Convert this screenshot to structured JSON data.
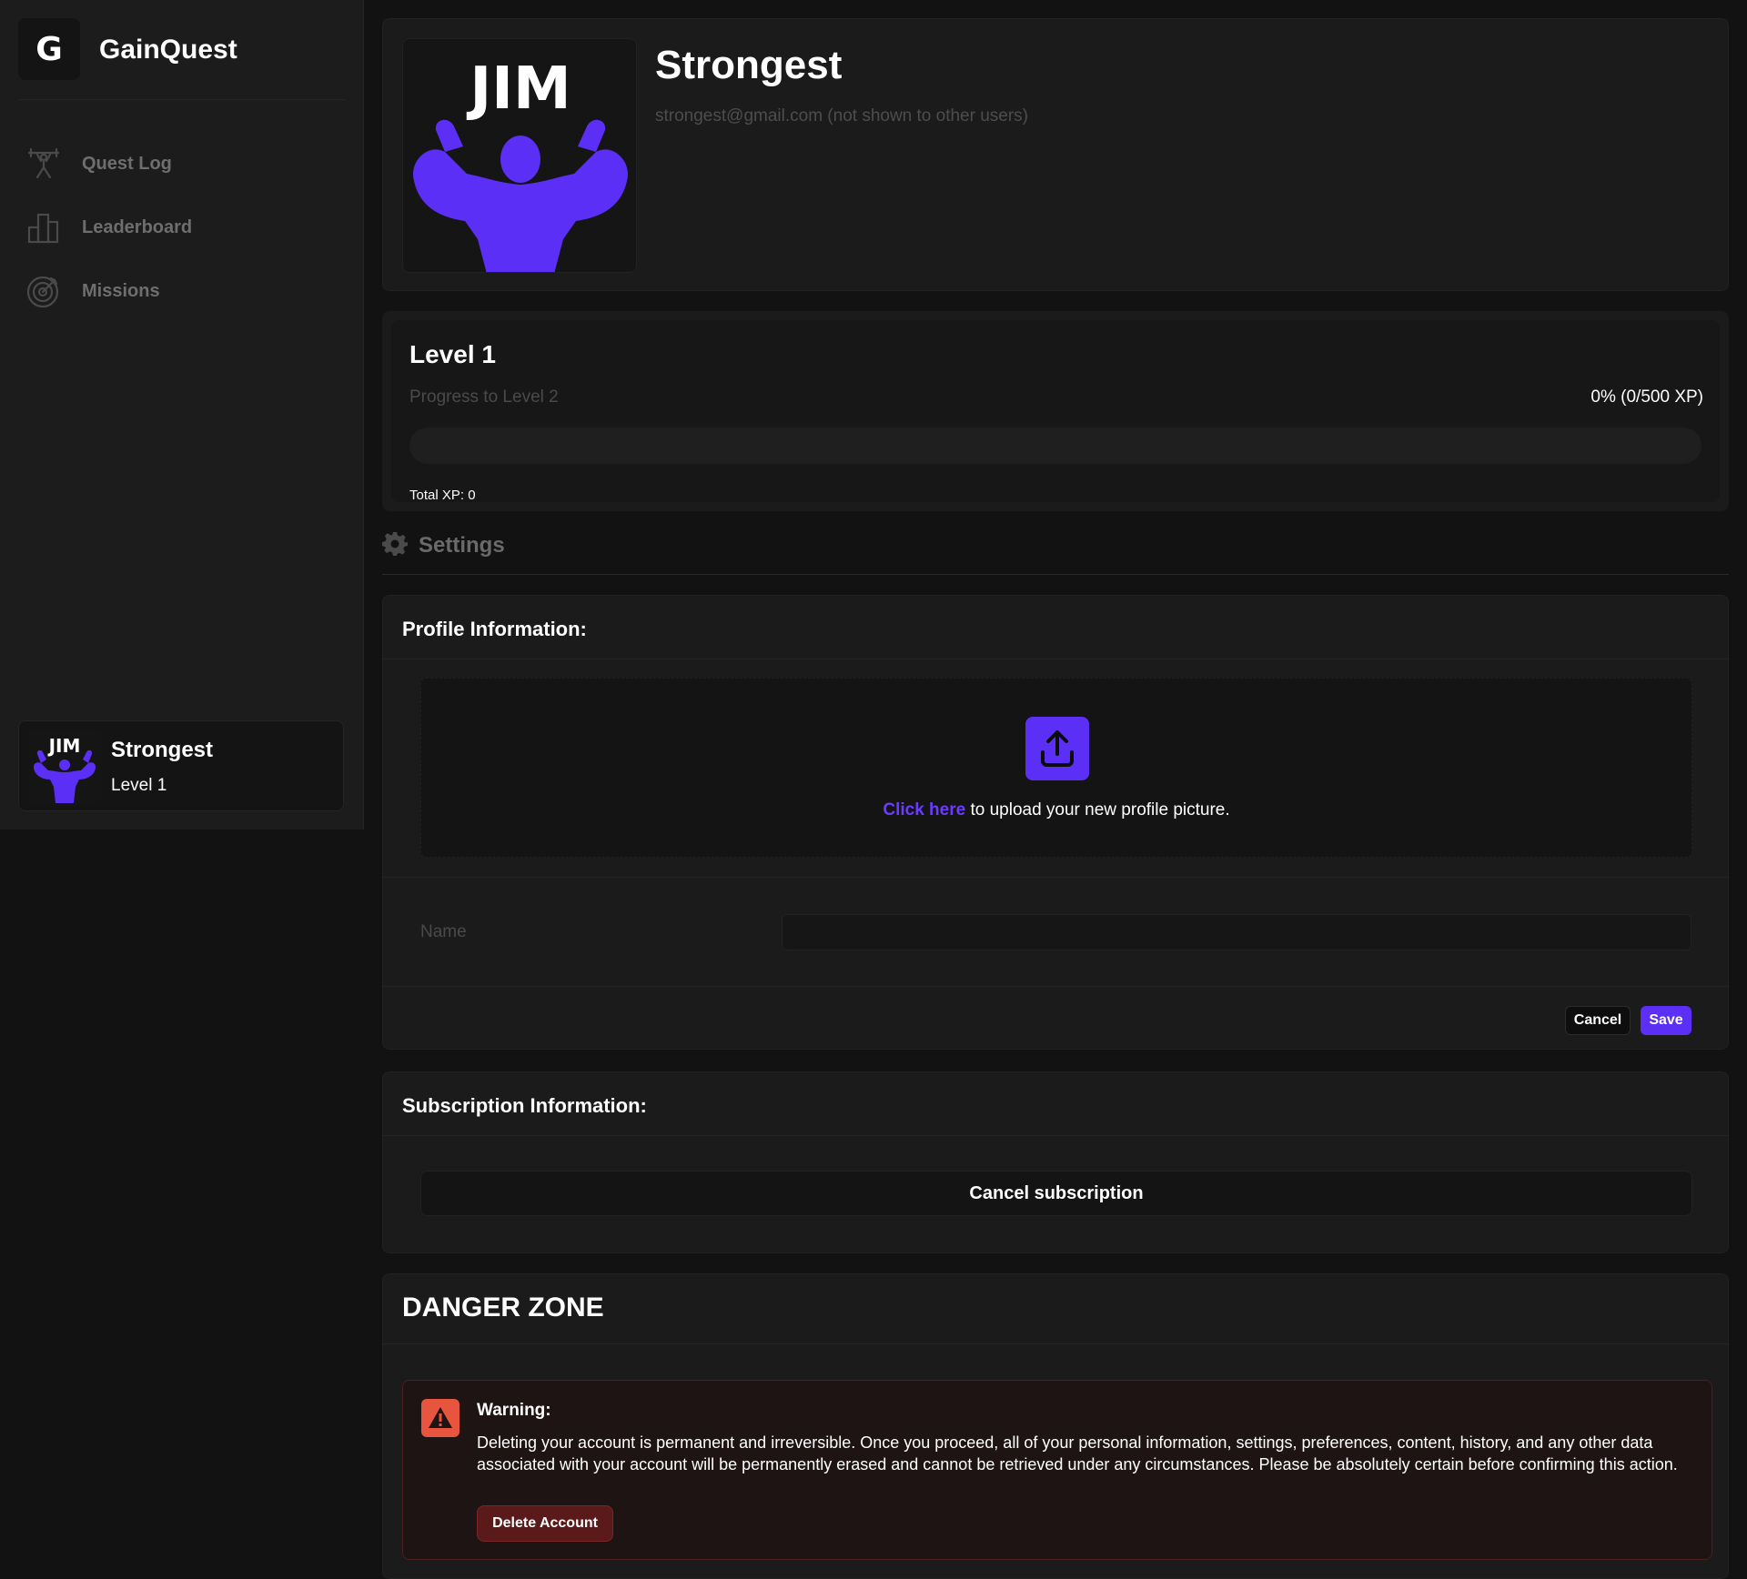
{
  "app": {
    "name": "GainQuest",
    "logo_letter": "G"
  },
  "sidebar": {
    "items": [
      {
        "label": "Quest Log",
        "icon": "weightlifter-icon"
      },
      {
        "label": "Leaderboard",
        "icon": "bar-chart-icon"
      },
      {
        "label": "Missions",
        "icon": "target-icon"
      }
    ],
    "user": {
      "name": "Strongest",
      "level": "Level 1",
      "avatar_text": "JIM"
    }
  },
  "profile": {
    "name": "Strongest",
    "email": "strongest@gmail.com (not shown to other users)",
    "avatar_text": "JIM"
  },
  "level": {
    "title": "Level 1",
    "progress_label": "Progress to Level 2",
    "progress_value": "0% (0/500 XP)",
    "progress_fraction": 0,
    "total_xp": "Total XP: 0"
  },
  "settings": {
    "label": "Settings"
  },
  "profile_info": {
    "title": "Profile Information:",
    "upload_link": "Click here",
    "upload_text": " to upload your new profile picture.",
    "name_label": "Name",
    "name_value": "",
    "cancel": "Cancel",
    "save": "Save"
  },
  "subscription": {
    "title": "Subscription Information:",
    "cancel_button": "Cancel subscription"
  },
  "danger": {
    "title": "DANGER ZONE",
    "warning_title": "Warning:",
    "warning_text": "Deleting your account is permanent and irreversible. Once you proceed, all of your personal information, settings, preferences, content, history, and any other data associated with your account will be permanently erased and cannot be retrieved under any circumstances. Please be absolutely certain before confirming this action.",
    "delete_button": "Delete Account"
  },
  "colors": {
    "accent": "#5b2ff5",
    "danger": "#e8553e",
    "background": "#121212"
  }
}
